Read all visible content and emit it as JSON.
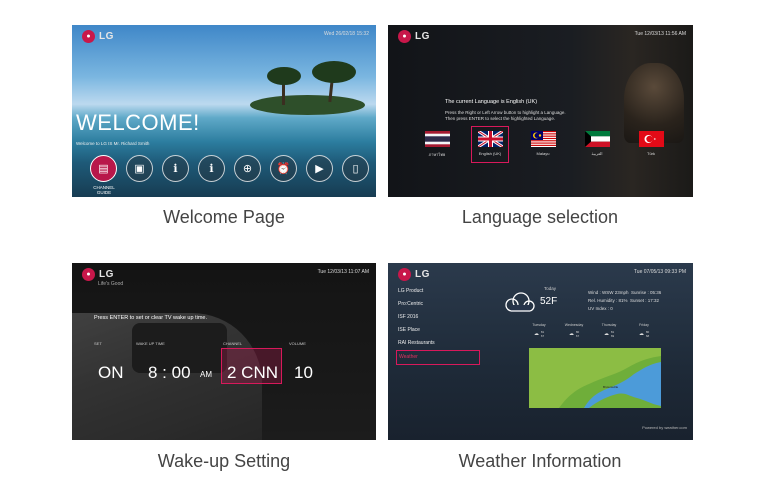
{
  "welcome_panel": {
    "logo": "LG",
    "datetime": "Wed 26/02/18 15:32",
    "headline": "WELCOME!",
    "subline": "Welcome to LG IS Mr. Richard Smith",
    "icons": [
      "tv-icon",
      "briefcase-icon",
      "info-icon",
      "info-icon",
      "globe-icon",
      "alarm-icon",
      "play-icon",
      "phone-icon"
    ],
    "active_icon_label": "CHANNEL GUIDE"
  },
  "language_panel": {
    "logo": "LG",
    "datetime": "Tue 12/03/13 11:56 AM",
    "current": "The current Language is English (UK)",
    "help_line1": "Press the Right or Left Arrow button to highlight a Language.",
    "help_line2": "Then press ENTER to select the highlighted Language.",
    "flags": [
      {
        "name": "thai-flag",
        "label": "ภาษาไทย"
      },
      {
        "name": "uk-flag",
        "label": "English (UK)",
        "selected": true
      },
      {
        "name": "malaysia-flag",
        "label": "Malayu"
      },
      {
        "name": "kuwait-flag",
        "label": "العربية"
      },
      {
        "name": "turkey-flag",
        "label": "Türk"
      }
    ]
  },
  "wakeup_panel": {
    "logo": "LG",
    "logo_sub": "Life's Good",
    "datetime": "Tue 12/03/13 11:07 AM",
    "instruction": "Press ENTER to set or clear TV wake up time.",
    "headers": {
      "set": "SET",
      "wake": "WAKE UP TIME",
      "channel": "CHANNEL",
      "volume": "VOLUME"
    },
    "set_value": "ON",
    "time_value": "8 : 00",
    "ampm": "AM",
    "channel_value": "2 CNN",
    "volume_value": "10"
  },
  "weather_panel": {
    "logo": "LG",
    "datetime": "Tue 07/05/13 09:33 PM",
    "menu": [
      "LG Product",
      "Pro:Centric",
      "ISF 2016",
      "ISE Place",
      "RAI Restaurants",
      "Weather"
    ],
    "selected_menu": "Weather",
    "today_label": "Today",
    "temperature": "52F",
    "wind": "Wind : WSW 23mph",
    "sunrise": "Sunrise : 05:36",
    "humidity": "Rel. Humidity : 81%",
    "sunset": "Sunset : 17:32",
    "uv": "UV Index : 0",
    "forecast": [
      {
        "day": "Tuesday",
        "hi": "81",
        "lo": "67"
      },
      {
        "day": "Wednesday",
        "hi": "80",
        "lo": "67"
      },
      {
        "day": "Thursday",
        "hi": "81",
        "lo": "69"
      },
      {
        "day": "Friday",
        "hi": "80",
        "lo": "68"
      }
    ],
    "map_label": "Brownsville",
    "powered": "Powered by weather.com"
  },
  "captions": {
    "welcome": "Welcome Page",
    "language": "Language selection",
    "wakeup": "Wake-up Setting",
    "weather": "Weather Information"
  },
  "colors": {
    "accent": "#d8195b",
    "lg_red": "#c8174a"
  }
}
